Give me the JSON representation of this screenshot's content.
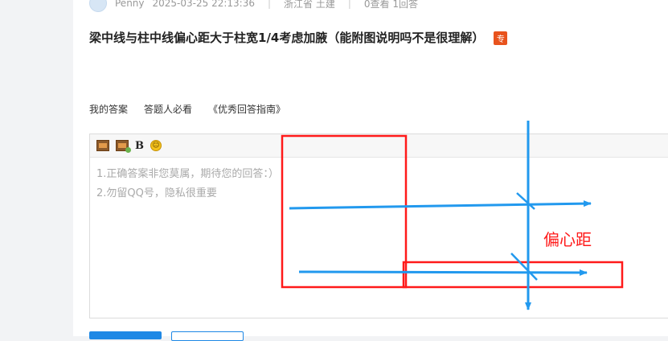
{
  "meta": {
    "author": "Penny",
    "datetime": "2025-03-25 22:13:36",
    "location": "浙江省 土建",
    "stats": "0查看 1回答"
  },
  "question": {
    "title": "梁中线与柱中线偏心距大于柱宽1/4考虑加腋（能附图说明吗不是很理解）",
    "badge": "专"
  },
  "answer_bar": {
    "my_answer": "我的答案",
    "guide_required": "答题人必看",
    "guide_link": "《优秀回答指南》"
  },
  "editor": {
    "toolbar": {
      "image_icon": "image-icon",
      "image_upload_icon": "image-upload-icon",
      "bold_label": "B",
      "emoji_icon": "emoji-icon"
    },
    "placeholder_lines": [
      "1.正确答案非您莫属，期待您的回答：）",
      "2.勿留QQ号，隐私很重要"
    ]
  },
  "annotation": {
    "label": "偏心距",
    "red": "#ff1a1a",
    "blue": "#2299ee"
  }
}
